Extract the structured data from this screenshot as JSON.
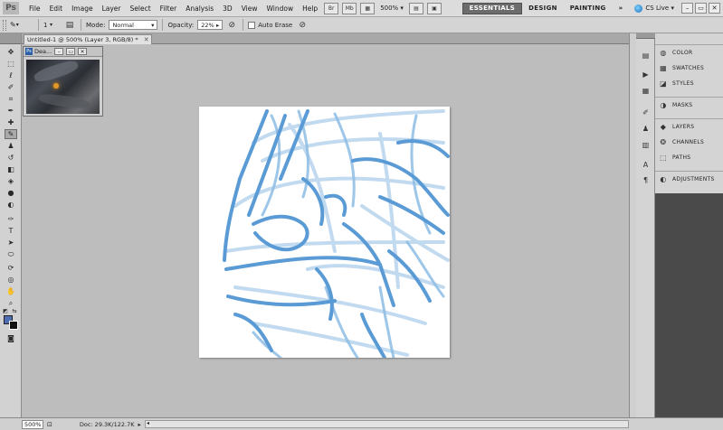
{
  "app": {
    "logo_text": "Ps"
  },
  "menu": [
    "File",
    "Edit",
    "Image",
    "Layer",
    "Select",
    "Filter",
    "Analysis",
    "3D",
    "View",
    "Window",
    "Help"
  ],
  "menubar_tools": {
    "zoom_value": "500%"
  },
  "workspaces": [
    "ESSENTIALS",
    "DESIGN",
    "PAINTING"
  ],
  "workspace_more": "»",
  "cs_live": "CS Live",
  "options": {
    "brush_size": "1",
    "mode_label": "Mode:",
    "mode_value": "Normal",
    "opacity_label": "Opacity:",
    "opacity_value": "22%",
    "auto_erase_label": "Auto Erase"
  },
  "document": {
    "tab_title": "Untitled-1 @ 500% (Layer 3, RGB/8) *"
  },
  "navigator": {
    "title": "Dea..."
  },
  "panels": {
    "group1": [
      "COLOR",
      "SWATCHES",
      "STYLES"
    ],
    "group2": [
      "MASKS"
    ],
    "group3": [
      "LAYERS",
      "CHANNELS",
      "PATHS"
    ],
    "group4": [
      "ADJUSTMENTS"
    ]
  },
  "status": {
    "zoom": "500%",
    "doc_info": "Doc: 29.3K/122.7K"
  },
  "colors": {
    "foreground": "#4d6eb4",
    "background": "#111111",
    "stroke_blue": "#5b9bd5"
  }
}
